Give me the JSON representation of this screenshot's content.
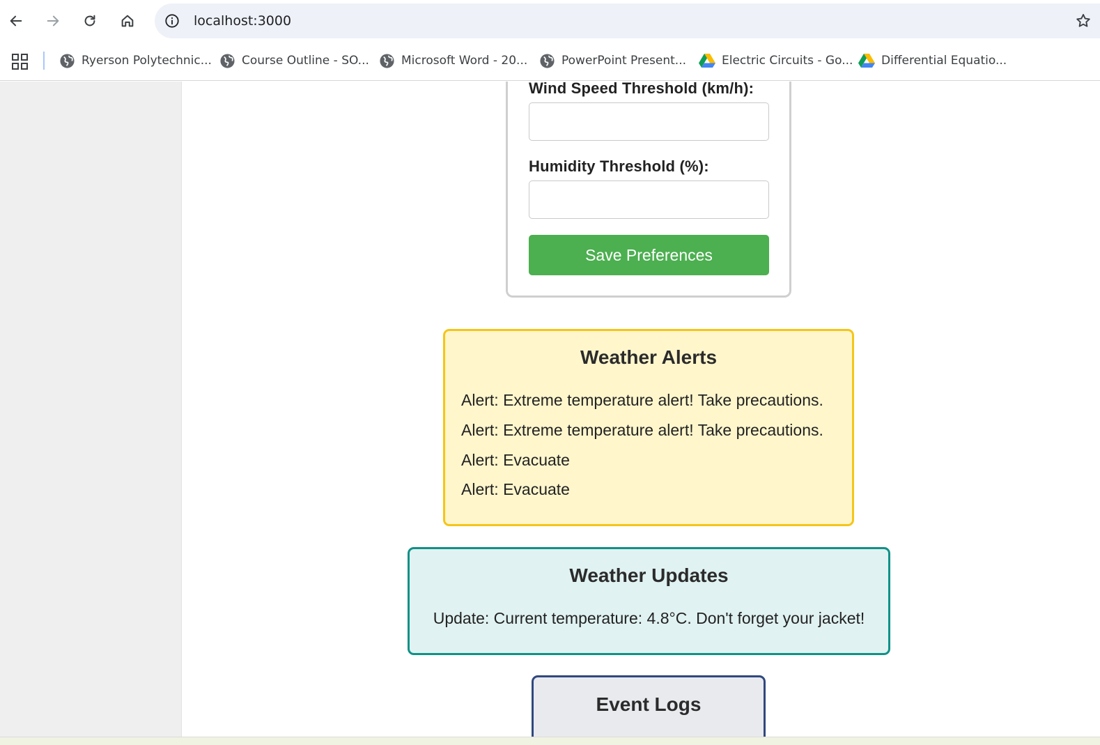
{
  "browser": {
    "url": "localhost:3000",
    "bookmarks": [
      {
        "label": "Ryerson Polytechnic...",
        "icon": "globe-icon"
      },
      {
        "label": "Course Outline - SO...",
        "icon": "globe-icon"
      },
      {
        "label": "Microsoft Word - 20...",
        "icon": "globe-icon"
      },
      {
        "label": "PowerPoint Present...",
        "icon": "globe-icon"
      },
      {
        "label": "Electric Circuits - Go...",
        "icon": "google-drive-icon"
      },
      {
        "label": "Differential Equatio...",
        "icon": "google-drive-icon"
      }
    ]
  },
  "preferences": {
    "wind_label": "Wind Speed Threshold (km/h):",
    "wind_value": "",
    "humidity_label": "Humidity Threshold (%):",
    "humidity_value": "",
    "save_label": "Save Preferences"
  },
  "alerts": {
    "title": "Weather Alerts",
    "items": [
      "Alert: Extreme temperature alert! Take precautions.",
      "Alert: Extreme temperature alert! Take precautions.",
      "Alert: Evacuate",
      "Alert: Evacuate"
    ]
  },
  "updates": {
    "title": "Weather Updates",
    "items": [
      "Update: Current temperature: 4.8°C. Don't forget your jacket!"
    ]
  },
  "logs": {
    "title": "Event Logs"
  },
  "colors": {
    "save_button": "#4caf50",
    "alerts_bg": "#fff6cc",
    "alerts_border": "#f5c518",
    "updates_bg": "#e0f2f1",
    "updates_border": "#119187",
    "logs_border": "#30487f"
  }
}
